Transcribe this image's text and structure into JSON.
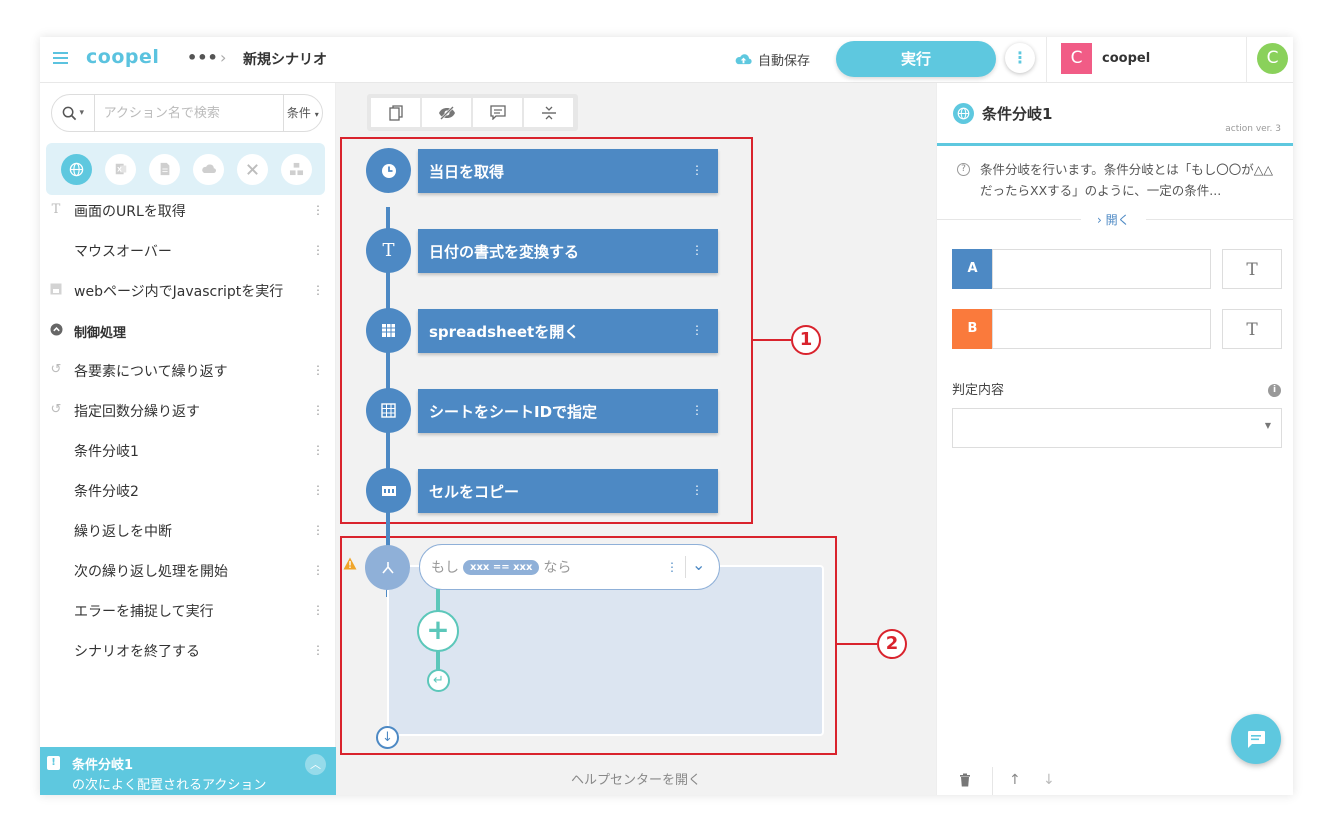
{
  "header": {
    "logo": "coopel",
    "more_dots": "•••",
    "breadcrumb_sep": "›",
    "scenario_title": "新規シナリオ",
    "autosave_label": "自動保存",
    "run_label": "実行",
    "org_initial": "C",
    "org_name": "coopel",
    "user_initial": "C"
  },
  "sidebar": {
    "search_placeholder": "アクション名で検索",
    "condition_label": "条件",
    "categories": [
      "web",
      "excel",
      "file",
      "cloud",
      "tools",
      "control"
    ],
    "items": [
      {
        "label": "画面のURLを取得",
        "icon": "text-icon"
      },
      {
        "label": "マウスオーバー",
        "icon": ""
      },
      {
        "label": "webページ内でJavascriptを実行",
        "icon": "script-icon"
      },
      {
        "label": "制御処理",
        "icon": "chevron-up-icon",
        "section": true
      },
      {
        "label": "各要素について繰り返す",
        "icon": "loop-icon"
      },
      {
        "label": "指定回数分繰り返す",
        "icon": "loop-icon"
      },
      {
        "label": "条件分岐1",
        "icon": ""
      },
      {
        "label": "条件分岐2",
        "icon": ""
      },
      {
        "label": "繰り返しを中断",
        "icon": ""
      },
      {
        "label": "次の繰り返し処理を開始",
        "icon": ""
      },
      {
        "label": "エラーを捕捉して実行",
        "icon": ""
      },
      {
        "label": "シナリオを終了する",
        "icon": ""
      }
    ],
    "suggestion": {
      "title": "条件分岐1",
      "subtitle": "の次によく配置されるアクション"
    }
  },
  "canvas": {
    "toolbar": [
      "copy-icon",
      "hide-icon",
      "comment-icon",
      "collapse-icon"
    ],
    "nodes": [
      {
        "label": "当日を取得",
        "icon": "clock-icon"
      },
      {
        "label": "日付の書式を変換する",
        "icon": "text-icon"
      },
      {
        "label": "spreadsheetを開く",
        "icon": "sheet-icon"
      },
      {
        "label": "シートをシートIDで指定",
        "icon": "grid-icon"
      },
      {
        "label": "セルをコピー",
        "icon": "cells-icon"
      }
    ],
    "condition": {
      "prefix": "もし",
      "expression": "xxx == xxx",
      "suffix": "なら"
    },
    "callouts": [
      "1",
      "2"
    ],
    "help_link": "ヘルプセンターを開く"
  },
  "right_panel": {
    "title": "条件分岐1",
    "version": "action ver. 3",
    "description": "条件分岐を行います。条件分岐とは「もし〇〇が△△だったらXXする」のように、一定の条件...",
    "open_label": "› 開く",
    "field_a_tag": "A",
    "field_b_tag": "B",
    "field_a_value": "",
    "field_b_value": "",
    "type_label": "T",
    "judge_label": "判定内容",
    "judge_value": ""
  },
  "colors": {
    "accent": "#5ec8df",
    "node_blue": "#4d89c4",
    "field_a": "#4d89c4",
    "field_b": "#fa7a3c",
    "callout_red": "#d9232d",
    "teal": "#5cc7ba"
  }
}
